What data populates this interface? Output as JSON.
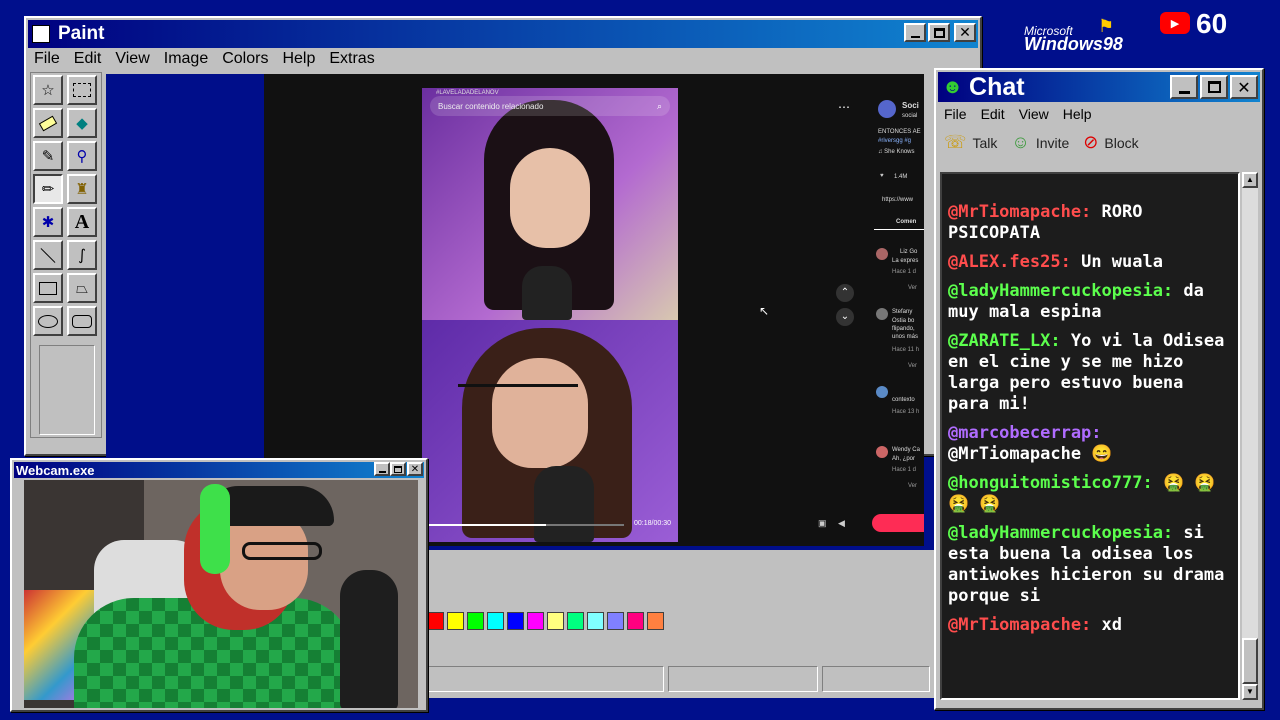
{
  "paint": {
    "title": "Paint",
    "menu": [
      "File",
      "Edit",
      "View",
      "Image",
      "Colors",
      "Help",
      "Extras"
    ],
    "palette": [
      "#ff0000",
      "#ffff00",
      "#00ff00",
      "#00ffff",
      "#0000ff",
      "#ff00ff",
      "#ffff80",
      "#00ff80",
      "#80ffff",
      "#8080ff",
      "#ff0080",
      "#ff8040"
    ]
  },
  "video": {
    "search_placeholder": "Buscar contenido relacionado",
    "hashtag": "#LAVELADADELANOV",
    "time": "00:18/00:30",
    "sidebar": {
      "account": "Soci",
      "account_sub": "social",
      "caption": "ENTONCES AE",
      "tags": "#riversgg #g",
      "music": "♫ She Knows",
      "likes": "1.4M",
      "link": "https://www",
      "comments_tab": "Comen",
      "comments": [
        {
          "name": "Liz Go",
          "text": "La expres",
          "time": "Hace 1 d"
        },
        {
          "name": "Stefany",
          "text": "Ostia bo",
          "text2": "flipando,",
          "text3": "unos más",
          "time": "Hace 11 h"
        },
        {
          "name": "",
          "text": "contexto",
          "time": "Hace 13 h"
        },
        {
          "name": "Wendy Ca",
          "text": "Ah, ¿por",
          "time": "Hace 1 d"
        }
      ],
      "ver": "Ver"
    }
  },
  "webcam": {
    "title": "Webcam.exe"
  },
  "brand": {
    "microsoft": "Microsoft",
    "windows": "Windows98",
    "count": "60",
    "youtube_icon": "youtube-icon"
  },
  "chat": {
    "title": "Chat",
    "menu": [
      "File",
      "Edit",
      "View",
      "Help"
    ],
    "toolbar": {
      "talk": "Talk",
      "invite": "Invite",
      "block": "Block"
    },
    "messages": [
      {
        "user": "@MrTiomapache:",
        "text": "RORO PSICOPATA",
        "color": "#ff4d4d"
      },
      {
        "user": "@ALEX.fes25:",
        "text": "Un wuala",
        "color": "#ff4d4d"
      },
      {
        "user": "@ladyHammercuckopesia:",
        "text": "da muy mala espina",
        "color": "#5cff4d"
      },
      {
        "user": "@ZARATE_LX:",
        "text": "Yo vi la Odisea en el cine y se me hizo larga pero estuvo buena para mi!",
        "color": "#5cff4d"
      },
      {
        "user": "@marcobecerrap:",
        "text": "@MrTiomapache 😄",
        "color": "#b06cff"
      },
      {
        "user": "@honguitomistico777:",
        "text": "🤮 🤮 🤮 🤮",
        "color": "#5cff4d"
      },
      {
        "user": "@ladyHammercuckopesia:",
        "text": "si esta buena la odisea los antiwokes hicieron su drama porque si",
        "color": "#5cff4d"
      },
      {
        "user": "@MrTiomapache:",
        "text": "xd",
        "color": "#ff4d4d"
      }
    ]
  }
}
